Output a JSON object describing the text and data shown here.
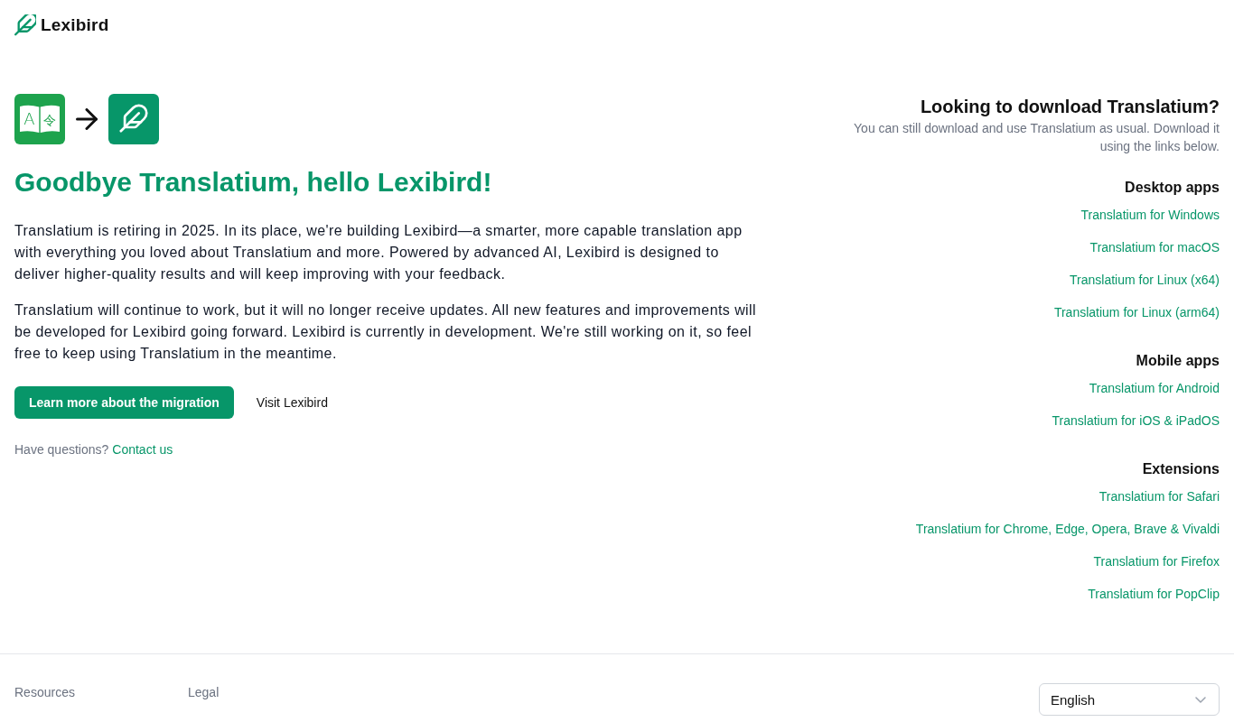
{
  "header": {
    "logo_text": "Lexibird"
  },
  "hero": {
    "app_icon_glyphs": [
      "A",
      "令"
    ],
    "title": "Goodbye Translatium, hello Lexibird!",
    "paragraphs": [
      "Translatium is retiring in 2025. In its place, we're building Lexibird—a smarter, more capable translation app with everything you loved about Translatium and more. Powered by advanced AI, Lexibird is designed to deliver higher-quality results and will keep improving with your feedback.",
      "Translatium will continue to work, but it will no longer receive updates. All new features and improvements will be developed for Lexibird going forward. Lexibird is currently in development. We're still working on it, so feel free to keep using Translatium in the meantime."
    ],
    "buttons": [
      {
        "label": "Learn more about the migration",
        "kind": "primary"
      },
      {
        "label": "Visit Lexibird",
        "kind": "plain"
      }
    ],
    "contact": {
      "prompt": "Have questions?",
      "link": "Contact us"
    }
  },
  "downloads": {
    "title": "Looking to download Translatium?",
    "subtitle": "You can still download and use Translatium as usual. Download it using the links below.",
    "groups": [
      {
        "heading": "Desktop apps",
        "links": [
          "Translatium for Windows",
          "Translatium for macOS",
          "Translatium for Linux (x64)",
          "Translatium for Linux (arm64)"
        ]
      },
      {
        "heading": "Mobile apps",
        "links": [
          "Translatium for Android",
          "Translatium for iOS & iPadOS"
        ]
      },
      {
        "heading": "Extensions",
        "links": [
          "Translatium for Safari",
          "Translatium for Chrome, Edge, Opera, Brave & Vivaldi",
          "Translatium for Firefox",
          "Translatium for PopClip"
        ]
      }
    ]
  },
  "footer": {
    "columns": [
      {
        "heading": "Resources"
      },
      {
        "heading": "Legal"
      }
    ],
    "language_select": {
      "value": "English"
    }
  }
}
